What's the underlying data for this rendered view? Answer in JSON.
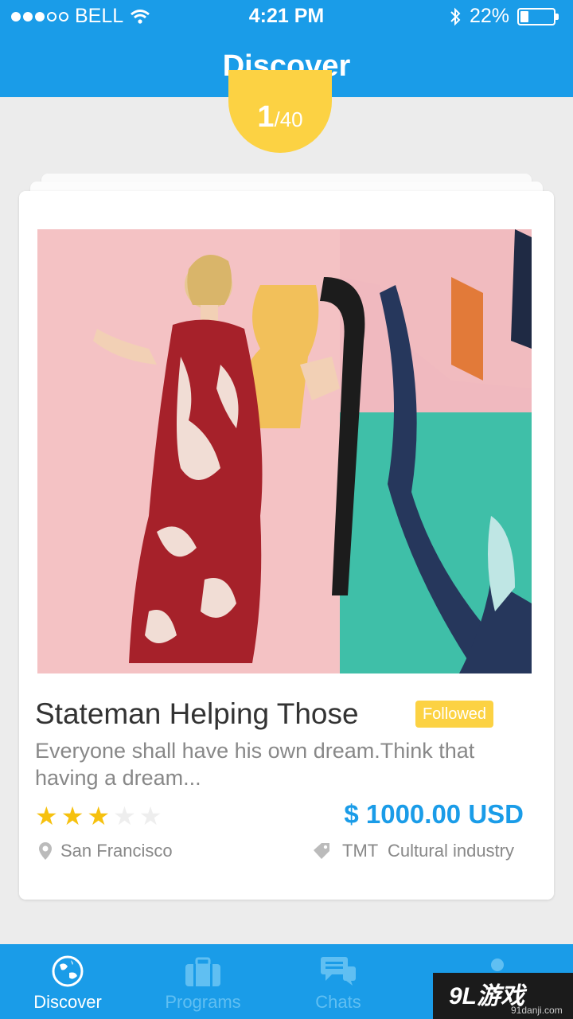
{
  "status_bar": {
    "carrier": "BELL",
    "time": "4:21 PM",
    "battery": "22%",
    "signal_bars": 3,
    "signal_total": 5
  },
  "header": {
    "title": "Discover"
  },
  "counter": {
    "current": "1",
    "total": "/40"
  },
  "card": {
    "title": "Stateman Helping Those",
    "badge": "Followed",
    "description": "Everyone shall have his own dream.Think that having a dream...",
    "rating": 3,
    "rating_max": 5,
    "price": "$ 1000.00 USD",
    "location": "San Francisco",
    "tags": "TMT  Cultural industry"
  },
  "tabs": [
    {
      "label": "Discover",
      "icon": "globe-icon",
      "active": true
    },
    {
      "label": "Programs",
      "icon": "briefcase-icon",
      "active": false
    },
    {
      "label": "Chats",
      "icon": "chat-bubbles-icon",
      "active": false
    },
    {
      "label": "",
      "icon": "person-icon",
      "active": false
    }
  ],
  "watermark": {
    "text": "9L游戏",
    "url_text": "91danji.com"
  },
  "colors": {
    "primary": "#1a9ce8",
    "accent": "#fcd243",
    "star": "#f6c10e"
  }
}
